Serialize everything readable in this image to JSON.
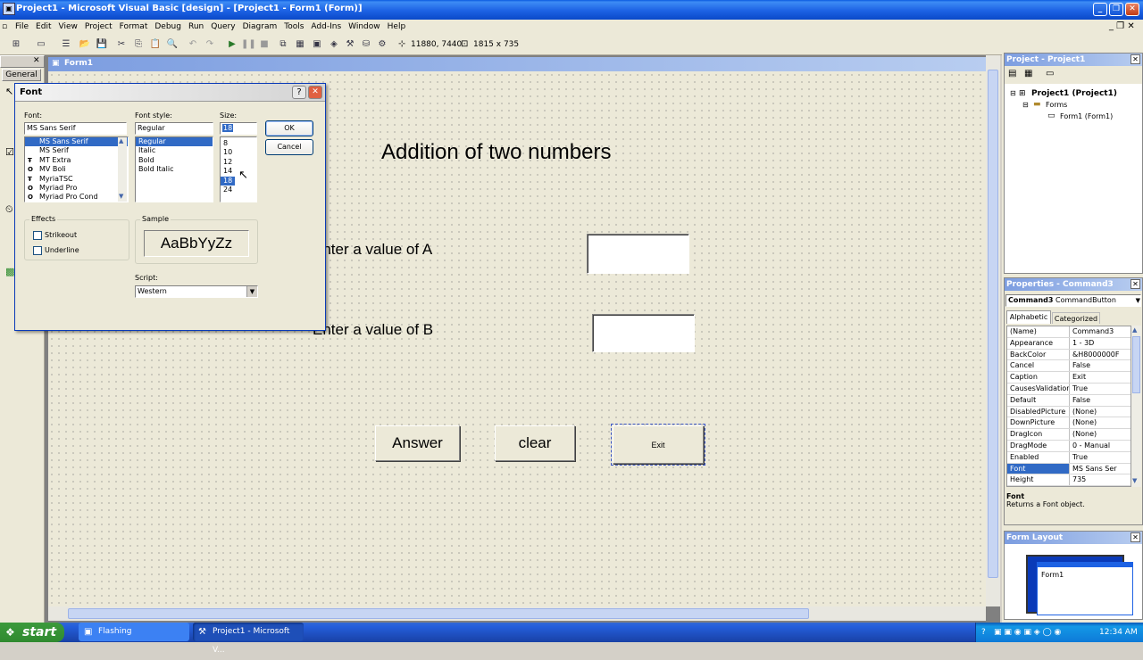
{
  "window": {
    "title": "Project1 - Microsoft Visual Basic [design] - [Project1 - Form1 (Form)]",
    "min": "_",
    "restore": "❐",
    "close": "✕"
  },
  "menubar": {
    "items": [
      "File",
      "Edit",
      "View",
      "Project",
      "Format",
      "Debug",
      "Run",
      "Query",
      "Diagram",
      "Tools",
      "Add-Ins",
      "Window",
      "Help"
    ]
  },
  "toolbar": {
    "position": "11880, 7440",
    "size": "1815 x 735"
  },
  "toolbox": {
    "title": "General",
    "close": "✕"
  },
  "form": {
    "title": "Form1",
    "heading": "Addition of two numbers",
    "label_a": "Enter a value of A",
    "label_b": "Enter a value of B",
    "btn_answer": "Answer",
    "btn_clear": "clear",
    "btn_exit": "Exit"
  },
  "font_dialog": {
    "title": "Font",
    "help": "?",
    "close": "✕",
    "font_label": "Font:",
    "font_value": "MS Sans Serif",
    "fonts": [
      "MS Sans Serif",
      "MS Serif",
      "MT Extra",
      "MV Boli",
      "MyriaTSC",
      "Myriad Pro",
      "Myriad Pro Cond"
    ],
    "font_icons": [
      "",
      "",
      "Ŧ",
      "O",
      "Ŧ",
      "O",
      "O"
    ],
    "style_label": "Font style:",
    "style_value": "Regular",
    "styles": [
      "Regular",
      "Italic",
      "Bold",
      "Bold Italic"
    ],
    "size_label": "Size:",
    "size_value": "18",
    "sizes": [
      "8",
      "10",
      "12",
      "14",
      "18",
      "24"
    ],
    "ok": "OK",
    "cancel": "Cancel",
    "effects_label": "Effects",
    "strikeout": "Strikeout",
    "underline": "Underline",
    "sample_label": "Sample",
    "sample_text": "AaBbYyZz",
    "script_label": "Script:",
    "script_value": "Western"
  },
  "project_panel": {
    "title": "Project - Project1",
    "root": "Project1 (Project1)",
    "folder": "Forms",
    "item": "Form1 (Form1)"
  },
  "properties_panel": {
    "title": "Properties - Command3",
    "object": "Command3",
    "object_type": "CommandButton",
    "tab_alpha": "Alphabetic",
    "tab_cat": "Categorized",
    "rows": [
      [
        "(Name)",
        "Command3"
      ],
      [
        "Appearance",
        "1 - 3D"
      ],
      [
        "BackColor",
        "&H8000000F"
      ],
      [
        "Cancel",
        "False"
      ],
      [
        "Caption",
        "Exit"
      ],
      [
        "CausesValidation",
        "True"
      ],
      [
        "Default",
        "False"
      ],
      [
        "DisabledPicture",
        "(None)"
      ],
      [
        "DownPicture",
        "(None)"
      ],
      [
        "DragIcon",
        "(None)"
      ],
      [
        "DragMode",
        "0 - Manual"
      ],
      [
        "Enabled",
        "True"
      ],
      [
        "Font",
        "MS Sans Ser"
      ],
      [
        "Height",
        "735"
      ]
    ],
    "desc_title": "Font",
    "desc_text": "Returns a Font object."
  },
  "form_layout": {
    "title": "Form Layout",
    "form_label": "Form1"
  },
  "taskbar": {
    "start": "start",
    "tasks": [
      "Flashing",
      "Project1 - Microsoft V..."
    ],
    "time": "12:34 AM"
  },
  "colors": {
    "xp_blue": "#1d62e4",
    "selection": "#316ac5",
    "start_green": "#3c9a3c"
  }
}
